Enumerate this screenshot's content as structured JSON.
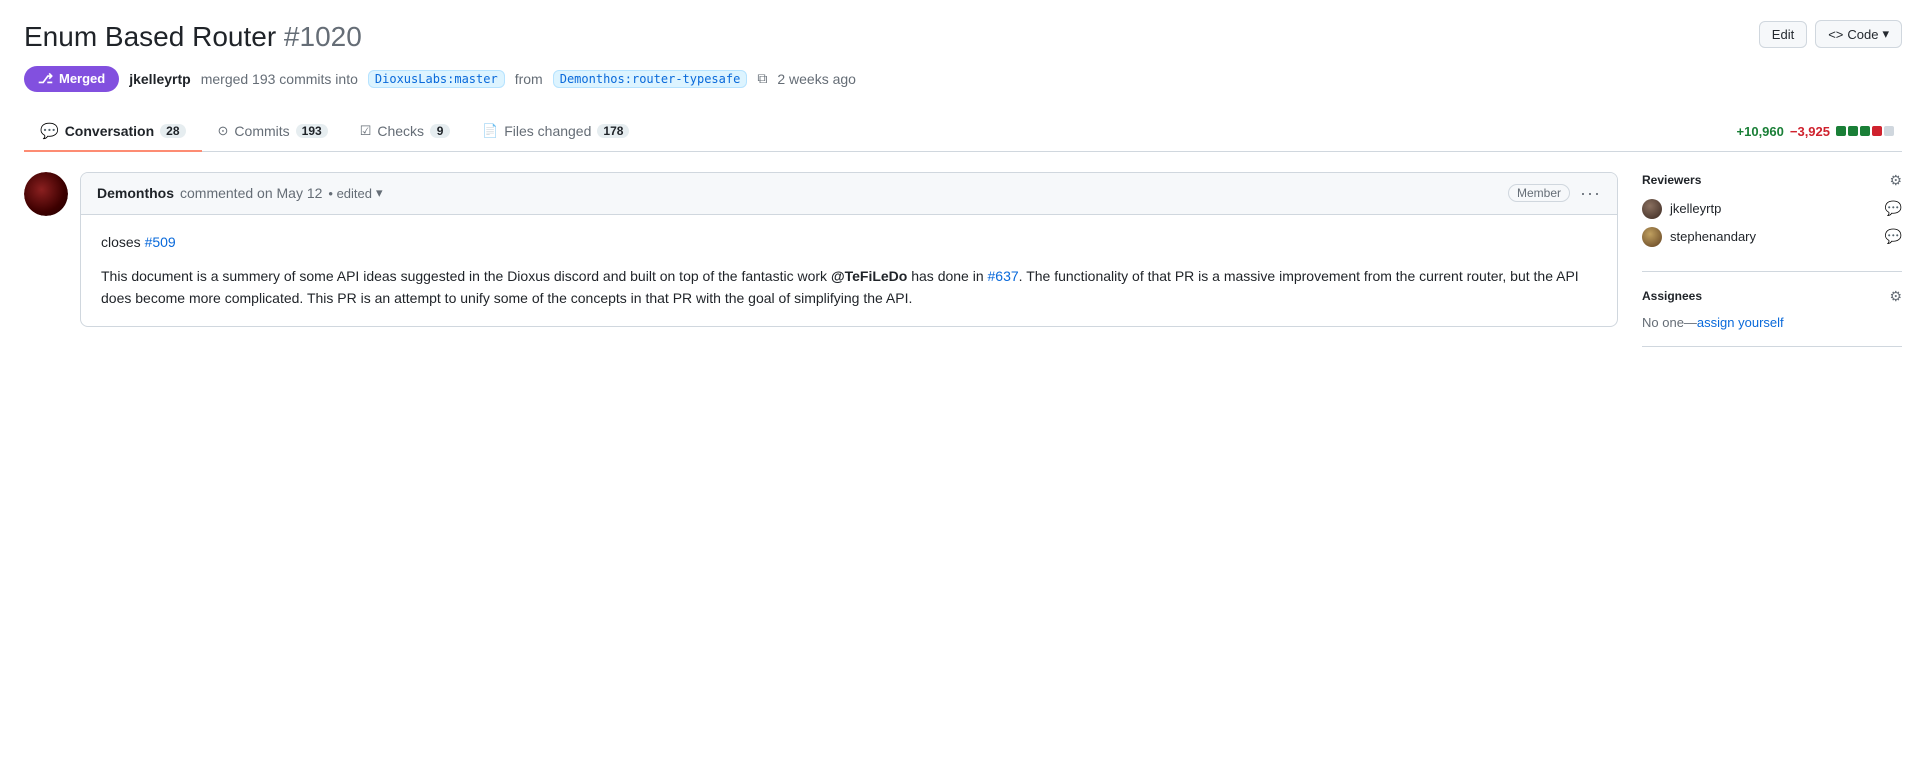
{
  "header": {
    "title": "Enum Based Router",
    "pr_number": "#1020",
    "edit_label": "Edit",
    "code_label": "<> Code"
  },
  "pr_meta": {
    "merged_label": "Merged",
    "merge_icon": "⎇",
    "author": "jkelleyrtp",
    "action": "merged 193 commits into",
    "target_branch": "DioxusLabs:master",
    "from_text": "from",
    "source_branch": "Demonthos:router-typesafe",
    "time_ago": "2 weeks ago"
  },
  "tabs": [
    {
      "id": "conversation",
      "label": "Conversation",
      "count": "28",
      "active": true
    },
    {
      "id": "commits",
      "label": "Commits",
      "count": "193",
      "active": false
    },
    {
      "id": "checks",
      "label": "Checks",
      "count": "9",
      "active": false
    },
    {
      "id": "files-changed",
      "label": "Files changed",
      "count": "178",
      "active": false
    }
  ],
  "diff_stats": {
    "additions": "+10,960",
    "deletions": "−3,925",
    "bars": [
      {
        "type": "green"
      },
      {
        "type": "green"
      },
      {
        "type": "green"
      },
      {
        "type": "red"
      },
      {
        "type": "gray"
      }
    ]
  },
  "comment": {
    "author": "Demonthos",
    "action": "commented on May 12",
    "edited_label": "• edited",
    "member_badge": "Member",
    "closes_prefix": "closes ",
    "closes_link": "#509",
    "closes_href": "#509",
    "body_1": "This document is a summery of some API ideas suggested in the Dioxus discord and built on top of the fantastic work ",
    "body_mention": "@TeFiLeDo",
    "body_2": " has done in ",
    "body_link": "#637",
    "body_3": ". The functionality of that PR is a massive improvement from the current router, but the API does become more complicated. This PR is an attempt to unify some of the concepts in that PR with the goal of simplifying the API."
  },
  "sidebar": {
    "reviewers_title": "Reviewers",
    "reviewers": [
      {
        "name": "jkelleyrtp"
      },
      {
        "name": "stephenandary"
      }
    ],
    "assignees_title": "Assignees",
    "assignees_none": "No one",
    "assign_yourself": "assign yourself"
  }
}
